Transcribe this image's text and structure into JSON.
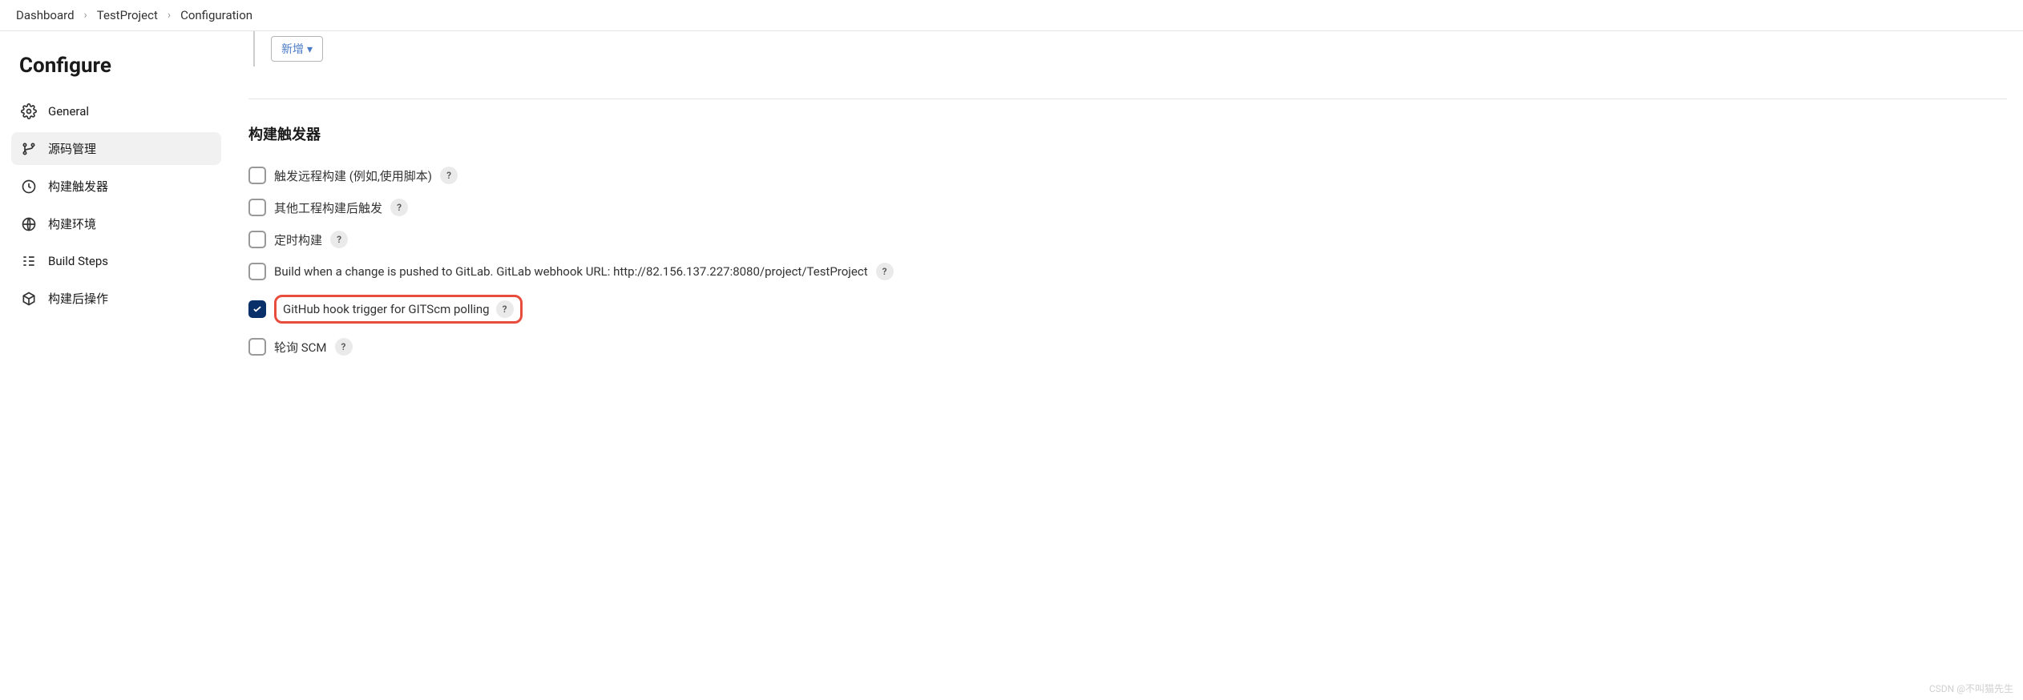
{
  "breadcrumb": {
    "items": [
      "Dashboard",
      "TestProject",
      "Configuration"
    ]
  },
  "sidebar": {
    "title": "Configure",
    "items": [
      {
        "icon": "gear",
        "label": "General",
        "active": false
      },
      {
        "icon": "branch",
        "label": "源码管理",
        "active": true
      },
      {
        "icon": "clock",
        "label": "构建触发器",
        "active": false
      },
      {
        "icon": "globe",
        "label": "构建环境",
        "active": false
      },
      {
        "icon": "steps",
        "label": "Build Steps",
        "active": false
      },
      {
        "icon": "package",
        "label": "构建后操作",
        "active": false
      }
    ]
  },
  "main": {
    "add_button_label": "新增",
    "section_title": "构建触发器",
    "triggers": [
      {
        "label": "触发远程构建 (例如,使用脚本)",
        "checked": false,
        "help": true,
        "highlight": false
      },
      {
        "label": "其他工程构建后触发",
        "checked": false,
        "help": true,
        "highlight": false
      },
      {
        "label": "定时构建",
        "checked": false,
        "help": true,
        "highlight": false
      },
      {
        "label": "Build when a change is pushed to GitLab. GitLab webhook URL: http://82.156.137.227:8080/project/TestProject",
        "checked": false,
        "help": true,
        "highlight": false
      },
      {
        "label": "GitHub hook trigger for GITScm polling",
        "checked": true,
        "help": true,
        "highlight": true
      },
      {
        "label": "轮询 SCM",
        "checked": false,
        "help": true,
        "highlight": false
      }
    ]
  },
  "watermark": "CSDN @不叫猫先生"
}
